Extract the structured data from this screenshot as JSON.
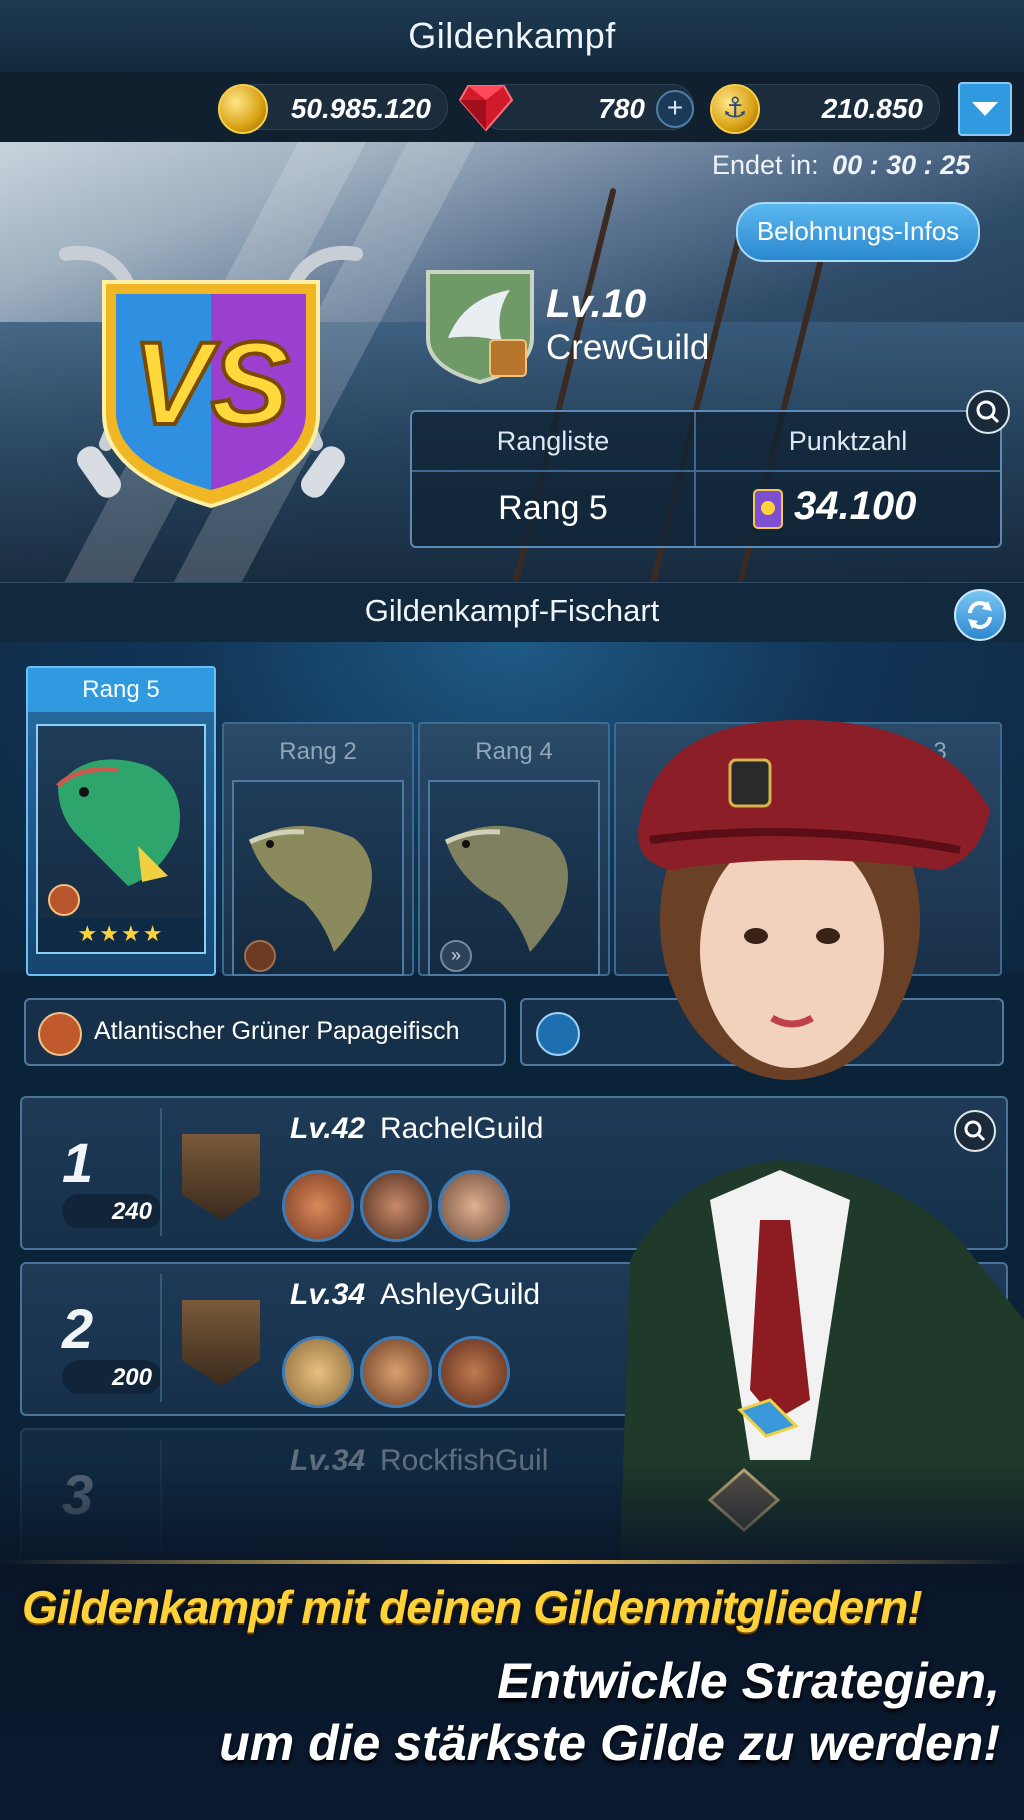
{
  "header": {
    "title": "Gildenkampf"
  },
  "currency": {
    "gold": "50.985.120",
    "gems": "780",
    "anchors": "210.850"
  },
  "event": {
    "ends_label": "Endet in:",
    "countdown": "00 : 30 : 25",
    "reward_button": "Belohnungs-Infos"
  },
  "guild": {
    "level": "Lv.10",
    "name": "CrewGuild",
    "rank_header": "Rangliste",
    "score_header": "Punktzahl",
    "rank_value": "Rang 5",
    "score_value": "34.100"
  },
  "fish_section": {
    "title": "Gildenkampf-Fischart",
    "cards": [
      {
        "label": "Rang 5",
        "stars": "★★★★"
      },
      {
        "label": "Rang 2"
      },
      {
        "label": "Rang 4"
      },
      {
        "label": "Rang 3"
      }
    ]
  },
  "filter": {
    "selected_fish": "Atlantischer Grüner Papageifisch"
  },
  "leaderboard": [
    {
      "rank": "1",
      "points": "240",
      "level": "Lv.42",
      "name": "RachelGuild"
    },
    {
      "rank": "2",
      "points": "200",
      "level": "Lv.34",
      "name": "AshleyGuild"
    },
    {
      "rank": "3",
      "level": "Lv.34",
      "name": "RockfishGuil"
    }
  ],
  "promo": {
    "line1": "Gildenkampf mit deinen Gildenmitgliedern!",
    "line2": "Entwickle Strategien,",
    "line3": "um die stärkste Gilde zu werden!"
  },
  "colors": {
    "accent_blue": "#2f9ae0",
    "gold_text": "#ffd23a",
    "panel_border": "#4a7399"
  }
}
